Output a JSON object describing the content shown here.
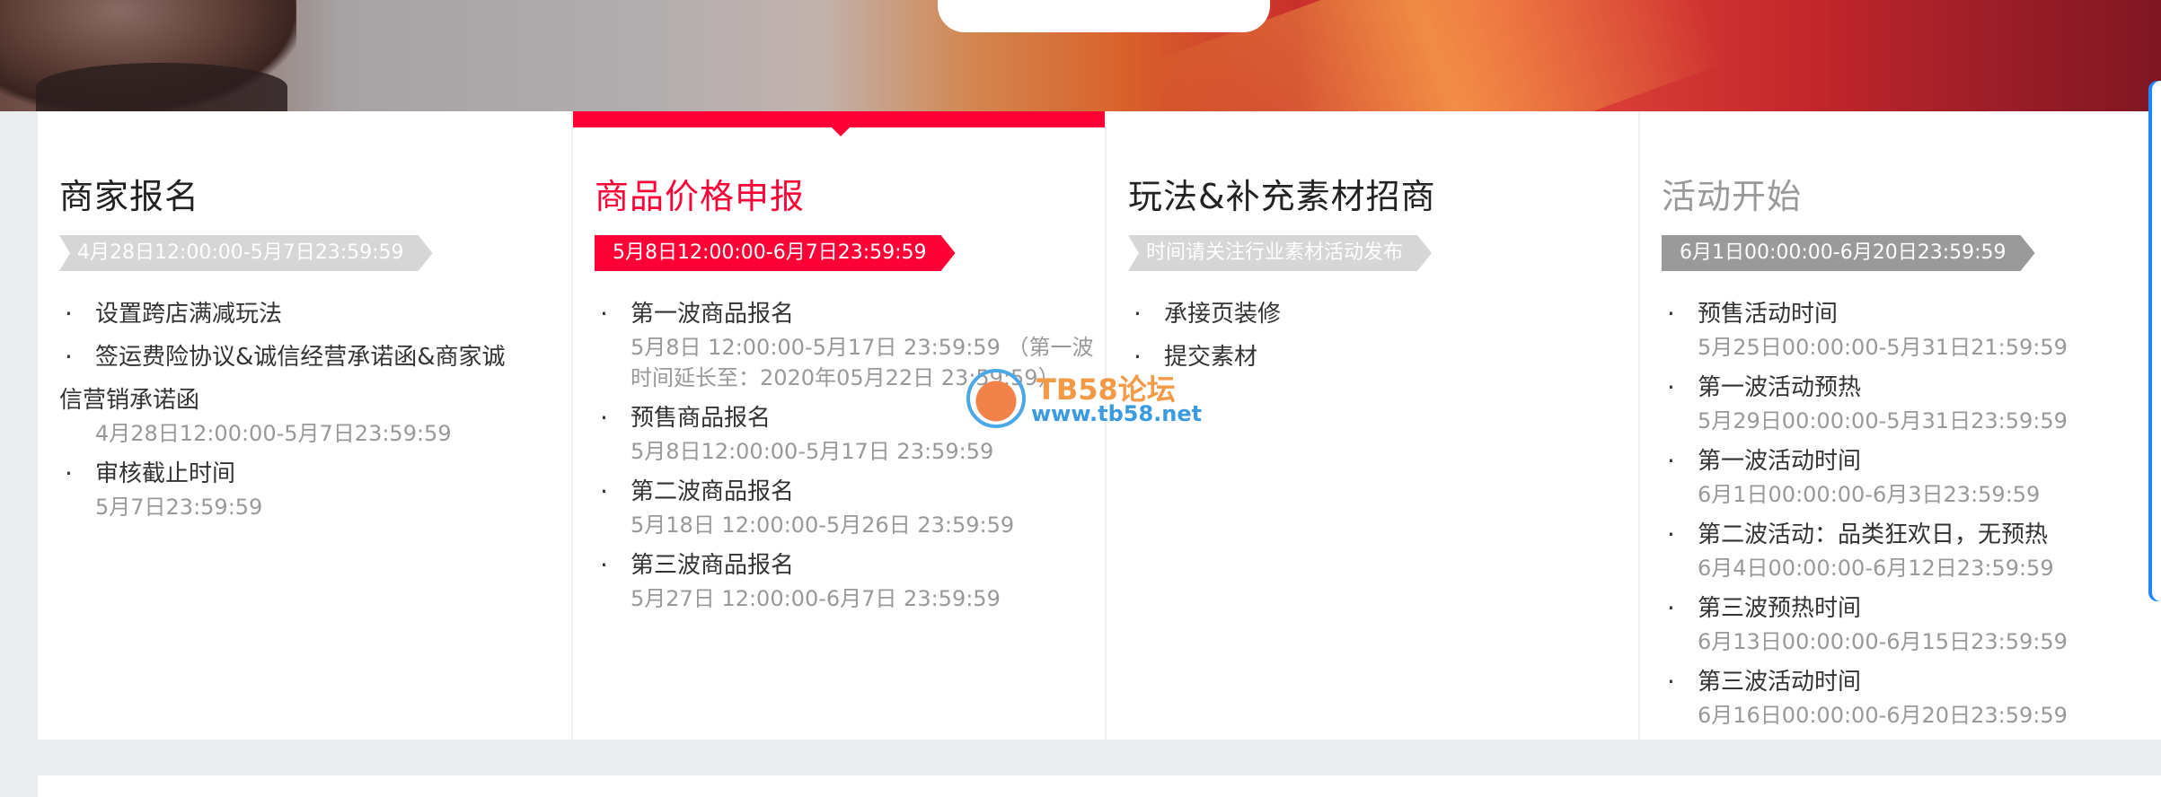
{
  "watermark": {
    "title": "TB58论坛",
    "url": "www.tb58.net"
  },
  "timeline": [
    {
      "title": "商家报名",
      "tag": "4月28日12:00:00-5月7日23:59:59",
      "items": [
        {
          "label": "设置跨店满减玩法",
          "sub": ""
        },
        {
          "label": "签运费险协议&诚信经营承诺函&商家诚",
          "label_rest": "信营销承诺函",
          "sub": "4月28日12:00:00-5月7日23:59:59"
        },
        {
          "label": "审核截止时间",
          "sub": "5月7日23:59:59"
        }
      ]
    },
    {
      "title": "商品价格申报",
      "tag": "5月8日12:00:00-6月7日23:59:59",
      "items": [
        {
          "label": "第一波商品报名",
          "sub": "5月8日 12:00:00-5月17日 23:59:59 （第一波时间延长至：2020年05月22日 23:59:59）"
        },
        {
          "label": "预售商品报名",
          "sub": "5月8日12:00:00-5月17日 23:59:59"
        },
        {
          "label": "第二波商品报名",
          "sub": "5月18日 12:00:00-5月26日 23:59:59"
        },
        {
          "label": "第三波商品报名",
          "sub": "5月27日 12:00:00-6月7日 23:59:59"
        }
      ]
    },
    {
      "title": "玩法&补充素材招商",
      "tag": "时间请关注行业素材活动发布",
      "items": [
        {
          "label": "承接页装修",
          "sub": ""
        },
        {
          "label": "提交素材",
          "sub": ""
        }
      ]
    },
    {
      "title": "活动开始",
      "tag": "6月1日00:00:00-6月20日23:59:59",
      "items": [
        {
          "label": "预售活动时间",
          "sub": "5月25日00:00:00-5月31日21:59:59"
        },
        {
          "label": "第一波活动预热",
          "sub": "5月29日00:00:00-5月31日23:59:59"
        },
        {
          "label": "第一波活动时间",
          "sub": "6月1日00:00:00-6月3日23:59:59"
        },
        {
          "label": "第二波活动：品类狂欢日，无预热",
          "sub": "6月4日00:00:00-6月12日23:59:59"
        },
        {
          "label": "第三波预热时间",
          "sub": "6月13日00:00:00-6月15日23:59:59"
        },
        {
          "label": "第三波活动时间",
          "sub": "6月16日00:00:00-6月20日23:59:59"
        }
      ]
    }
  ],
  "colors": {
    "accent": "#ff0036",
    "tag_default": "#d6d6d6",
    "tag_gray": "#9a9a9a",
    "sub_text": "#999999"
  }
}
